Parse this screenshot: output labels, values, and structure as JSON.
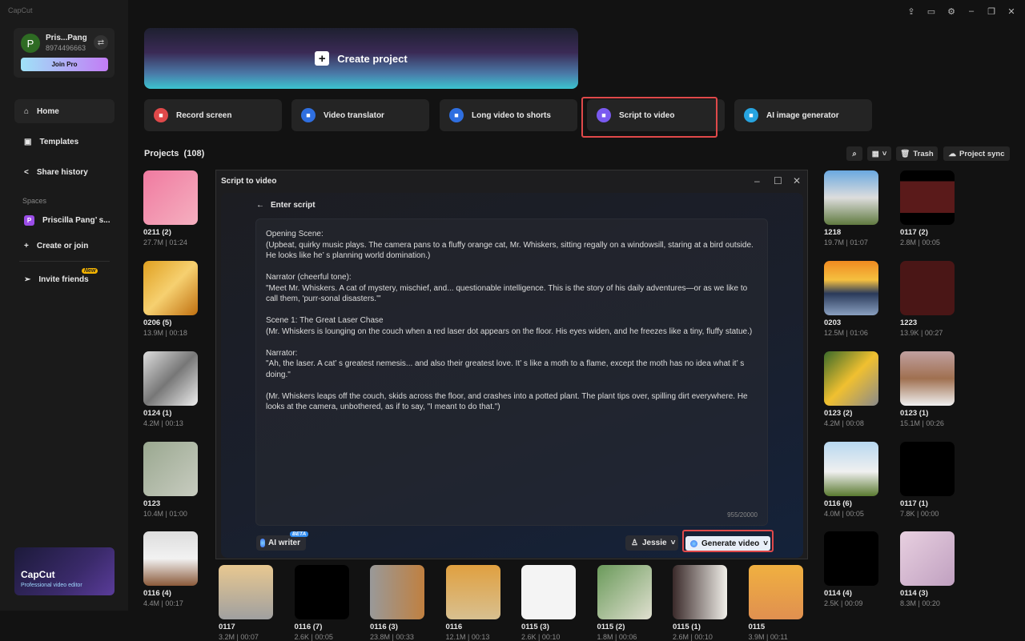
{
  "app": {
    "logo": "CapCut"
  },
  "user": {
    "initial": "P",
    "name": "Pris...Pang",
    "id": "8974496663",
    "join_pro": "Join Pro"
  },
  "nav": [
    {
      "label": "Home",
      "icon": "home-icon",
      "active": true
    },
    {
      "label": "Templates",
      "icon": "templates-icon"
    },
    {
      "label": "Share history",
      "icon": "share-icon"
    }
  ],
  "spaces": {
    "label": "Spaces",
    "space_initial": "P",
    "space_name": "Priscilla Pang’ s...",
    "create": "Create or join"
  },
  "invite": {
    "label": "Invite friends",
    "badge": "New"
  },
  "promo": {
    "title": "CapCut",
    "subtitle": "Professional video editor"
  },
  "banner": {
    "label": "Create project"
  },
  "tools": [
    {
      "label": "Record screen",
      "color": "#e0494a",
      "icon": "record-icon"
    },
    {
      "label": "Video translator",
      "color": "#2f6fe0",
      "icon": "translate-icon"
    },
    {
      "label": "Long video to shorts",
      "color": "#2f6fe0",
      "icon": "shorts-icon"
    },
    {
      "label": "Script to video",
      "color": "#7a5af0",
      "icon": "script-icon",
      "highlighted": true
    },
    {
      "label": "AI image generator",
      "color": "#27a4e0",
      "icon": "ai-image-icon"
    }
  ],
  "projects": {
    "title": "Projects",
    "count": "(108)",
    "trash": "Trash",
    "sync": "Project sync",
    "left": [
      {
        "name": "0211 (2)",
        "meta": "27.7M | 01:24",
        "bg": "linear-gradient(135deg,#f07aa0,#f5b0c0)"
      },
      {
        "name": "0206 (5)",
        "meta": "13.9M | 00:18",
        "bg": "linear-gradient(135deg,#e0a020,#f6d070,#c07010)"
      },
      {
        "name": "0124 (1)",
        "meta": "4.2M | 00:13",
        "bg": "linear-gradient(135deg,#ddd,#777,#eee)"
      },
      {
        "name": "0123",
        "meta": "10.4M | 01:00",
        "bg": "linear-gradient(135deg,#9aa890,#c8ccc0)"
      },
      {
        "name": "0116 (4)",
        "meta": "4.4M | 00:17",
        "bg": "linear-gradient(180deg,#ddd,#f2f2f2,#8a5a3a)"
      }
    ],
    "right": [
      [
        {
          "name": "1218",
          "meta": "19.7M | 01:07",
          "bg": "linear-gradient(180deg,#6aa8e0,#ddd,#607a40)"
        },
        {
          "name": "0117 (2)",
          "meta": "2.8M | 00:05",
          "bg": "linear-gradient(180deg,#000 20%,#5a1a1a 20%,#5a1a1a 78%,#000 78%)"
        }
      ],
      [
        {
          "name": "0203",
          "meta": "12.5M | 01:06",
          "bg": "linear-gradient(180deg,#f08a20,#f5c040 35%,#2a3a5a 60%,#8aa0c0)"
        },
        {
          "name": "1223",
          "meta": "13.9K | 00:27",
          "bg": "#4a1616"
        }
      ],
      [
        {
          "name": "0123 (2)",
          "meta": "4.2M | 00:08",
          "bg": "linear-gradient(135deg,#3a6a2a,#f0c030,#8a8a8a)"
        },
        {
          "name": "0123 (1)",
          "meta": "15.1M | 00:26",
          "bg": "linear-gradient(180deg,#c0a0a0,#a07050,#f0f0f0)"
        }
      ],
      [
        {
          "name": "0116 (6)",
          "meta": "4.0M | 00:05",
          "bg": "linear-gradient(180deg,#b8d8f0,#f0f0f0 55%,#5a7a30)"
        },
        {
          "name": "0117 (1)",
          "meta": "7.8K | 00:00",
          "bg": "#000"
        }
      ],
      [
        {
          "name": "0114 (4)",
          "meta": "2.5K | 00:09",
          "bg": "#000"
        },
        {
          "name": "0114 (3)",
          "meta": "8.3M | 00:20",
          "bg": "linear-gradient(135deg,#e8d0e0,#c0a0c0)"
        }
      ]
    ],
    "bottom": [
      {
        "name": "0117",
        "meta": "3.2M | 00:07",
        "bg": "linear-gradient(180deg,#e8c890,#a0a0a0)"
      },
      {
        "name": "0116 (7)",
        "meta": "2.6K | 00:05",
        "bg": "#000"
      },
      {
        "name": "0116 (3)",
        "meta": "23.8M | 00:33",
        "bg": "linear-gradient(90deg,#999,#c08040)"
      },
      {
        "name": "0116",
        "meta": "12.1M | 00:13",
        "bg": "linear-gradient(180deg,#e0a040,#d8c090)"
      },
      {
        "name": "0115 (3)",
        "meta": "2.6K | 00:10",
        "bg": "#f4f4f4"
      },
      {
        "name": "0115 (2)",
        "meta": "1.8M | 00:06",
        "bg": "linear-gradient(135deg,#6a9a5a,#e0e0d0)"
      },
      {
        "name": "0115 (1)",
        "meta": "2.6M | 00:10",
        "bg": "linear-gradient(90deg,#3a2a2a,#f0eee8)"
      },
      {
        "name": "0115",
        "meta": "3.9M | 00:11",
        "bg": "linear-gradient(180deg,#f0b040,#e09050)"
      }
    ]
  },
  "dialog": {
    "title": "Script to video",
    "back": "Enter script",
    "script": "Opening Scene:\n(Upbeat, quirky music plays. The camera pans to a fluffy orange cat, Mr. Whiskers, sitting regally on a windowsill, staring at a bird outside. He looks like he’ s planning world domination.)\n\nNarrator (cheerful tone):\n\"Meet Mr. Whiskers. A cat of mystery, mischief, and... questionable intelligence. This is the story of his daily adventures—or as we like to call them, 'purr-sonal disasters.'\"\n\nScene 1: The Great Laser Chase\n(Mr. Whiskers is lounging on the couch when a red laser dot appears on the floor. His eyes widen, and he freezes like a tiny, fluffy statue.)\n\nNarrator:\n\"Ah, the laser. A cat’ s greatest nemesis... and also their greatest love. It’ s like a moth to a flame, except the moth has no idea what it’ s doing.\"\n\n(Mr. Whiskers leaps off the couch, skids across the floor, and crashes into a potted plant. The plant tips over, spilling dirt everywhere. He looks at the camera, unbothered, as if to say, \"I meant to do that.\")",
    "counter": "955/20000",
    "ai_writer": "AI writer",
    "beta": "BETA",
    "voice": "Jessie",
    "generate": "Generate video"
  }
}
